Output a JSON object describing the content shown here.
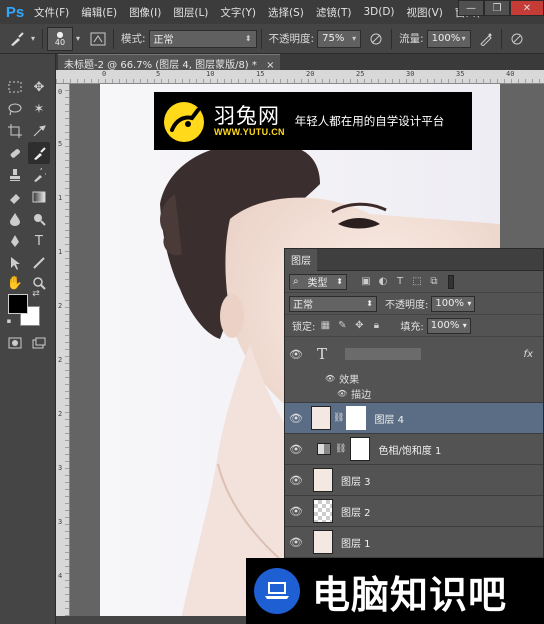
{
  "app": {
    "logo": "Ps"
  },
  "menu": [
    "文件(F)",
    "编辑(E)",
    "图像(I)",
    "图层(L)",
    "文字(Y)",
    "选择(S)",
    "滤镜(T)",
    "3D(D)",
    "视图(V)",
    "窗口(W"
  ],
  "window_controls": {
    "minimize": "—",
    "restore": "❐",
    "close": "✕"
  },
  "options": {
    "brush_size": "40",
    "mode_label": "模式:",
    "mode_value": "正常",
    "opacity_label": "不透明度:",
    "opacity_value": "75%",
    "flow_label": "流量:",
    "flow_value": "100%"
  },
  "document_tab": "未标题-2 @ 66.7% (图层 4, 图层蒙版/8) *",
  "ruler_h_ticks": [
    "0",
    "5",
    "10",
    "15",
    "20",
    "25",
    "30",
    "35",
    "40"
  ],
  "ruler_v_ticks": [
    "0",
    "5",
    "1",
    "1",
    "2",
    "2",
    "2",
    "3",
    "3",
    "4"
  ],
  "banner": {
    "brand": "羽兔网",
    "url": "WWW.YUTU.CN",
    "tagline": "年轻人都在用的自学设计平台"
  },
  "layers_panel": {
    "title": "图层",
    "filter_label": "类型",
    "blend_mode": "正常",
    "opacity_label": "不透明度:",
    "opacity_value": "100%",
    "lock_label": "锁定:",
    "fill_label": "填充:",
    "fill_value": "100%",
    "text_layer_icon": "T",
    "fx_label": "fx",
    "effects_label": "效果",
    "stroke_label": "描边",
    "layers": [
      {
        "name": "图层 4",
        "selected": true
      },
      {
        "name": "色相/饱和度 1",
        "selected": false
      },
      {
        "name": "图层 3",
        "selected": false
      },
      {
        "name": "图层 2",
        "selected": false
      },
      {
        "name": "图层 1",
        "selected": false
      }
    ]
  },
  "watermark": {
    "text": "电脑知识吧"
  },
  "colors": {
    "accent_blue": "#31a8ff",
    "brand_yellow": "#ffd91a",
    "selected_layer": "#5b6d85",
    "watermark_icon": "#1f5fd4"
  }
}
